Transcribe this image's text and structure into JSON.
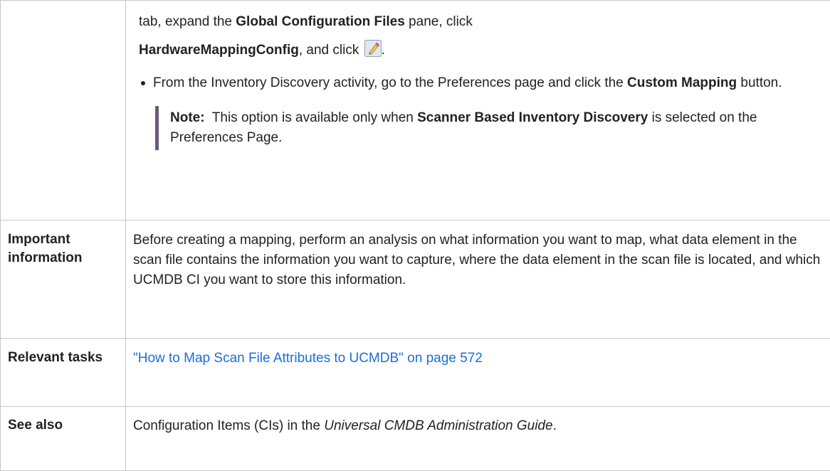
{
  "rows": [
    {
      "label": "",
      "continuation": {
        "prefix": "tab, expand the ",
        "bold1": "Global Configuration Files",
        "mid": " pane, click",
        "bold2": "HardwareMappingConfig",
        "suffix": ", and click ",
        "end": ".",
        "icon": "pencil-edit-icon"
      },
      "bullet": {
        "text1": "From the Inventory Discovery activity, go to the Preferences page and click the ",
        "bold": "Custom Mapping",
        "text2": " button."
      },
      "note": {
        "label": "Note:",
        "text1": "  This option is available only when ",
        "bold": "Scanner Based Inventory Discovery",
        "text2": " is selected on the Preferences Page."
      }
    },
    {
      "label": "Important information",
      "text": "Before creating a mapping, perform an analysis on what information you want to map, what data element in the scan file contains the information you want to capture, where the data element in the scan file is located, and which UCMDB CI you want to store this information."
    },
    {
      "label": "Relevant tasks",
      "link": "\"How to Map Scan File Attributes to UCMDB\" on page 572"
    },
    {
      "label": "See also",
      "text1": "Configuration Items (CIs) in the ",
      "italic": "Universal CMDB Administration Guide",
      "text2": "."
    }
  ],
  "colors": {
    "border": "#c8c8c8",
    "link": "#1a6fd8",
    "note_bar": "#6b5a7e"
  }
}
